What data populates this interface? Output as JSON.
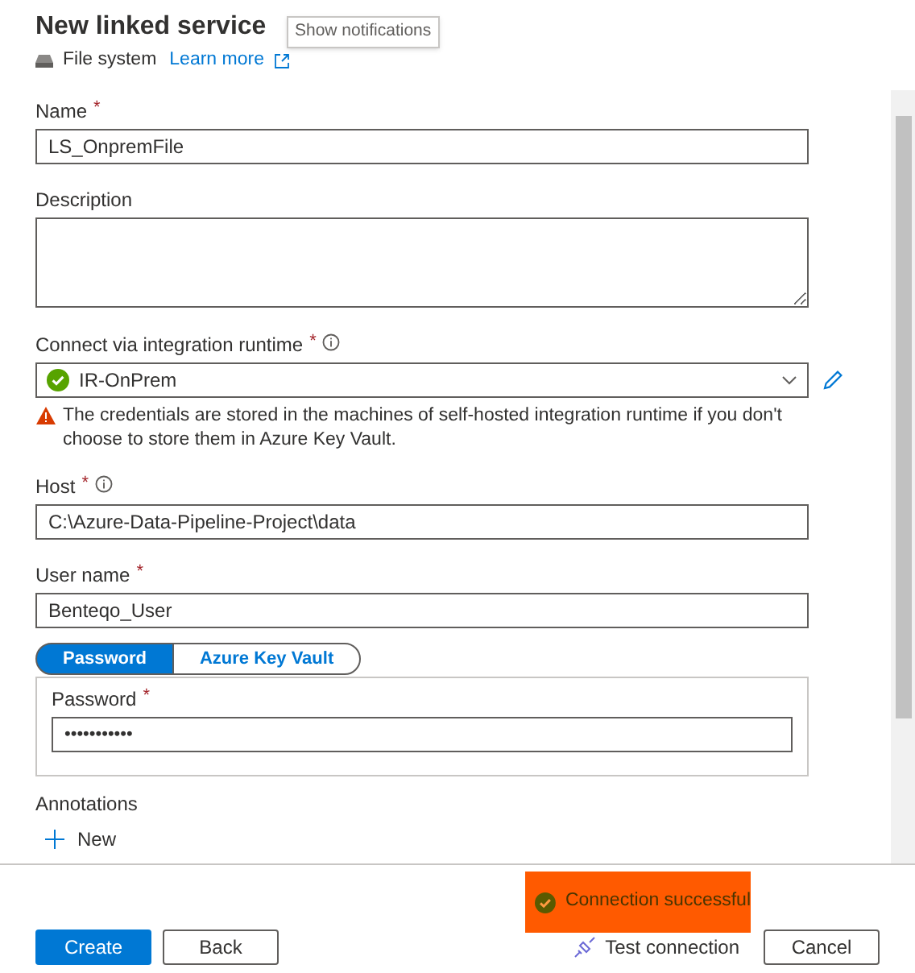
{
  "header": {
    "title": "New linked service",
    "subtitle": "File system",
    "learn_more": "Learn more"
  },
  "tooltip": "Show notifications",
  "fields": [
    {
      "kind": "text",
      "label": "Name",
      "required_mark": "*",
      "info": false,
      "value": "LS_OnpremFile"
    },
    {
      "kind": "textarea",
      "label": "Description",
      "info": false
    },
    {
      "kind": "select",
      "label": "Connect via integration runtime",
      "required_mark": "*",
      "info": true,
      "value": "IR-OnPrem",
      "warning": "The credentials are stored in the machines of self-hosted integration runtime if you don't choose to store them in Azure Key Vault."
    },
    {
      "kind": "text",
      "label": "Host",
      "required_mark": "*",
      "info": true,
      "value": "C:\\Azure-Data-Pipeline-Project\\data"
    },
    {
      "kind": "text",
      "label": "User name",
      "required_mark": "*",
      "info": false,
      "value": "Benteqo_User"
    }
  ],
  "auth_tabs": [
    {
      "label": "Password",
      "selected": true
    },
    {
      "label": "Azure Key Vault",
      "selected": false
    }
  ],
  "password": {
    "label": "Password",
    "required_mark": "*",
    "value": "•••••••••••"
  },
  "annotations": {
    "label": "Annotations",
    "new": "New"
  },
  "status": "Connection successful",
  "buttons": {
    "create": "Create",
    "back": "Back",
    "test": "Test connection",
    "cancel": "Cancel"
  }
}
